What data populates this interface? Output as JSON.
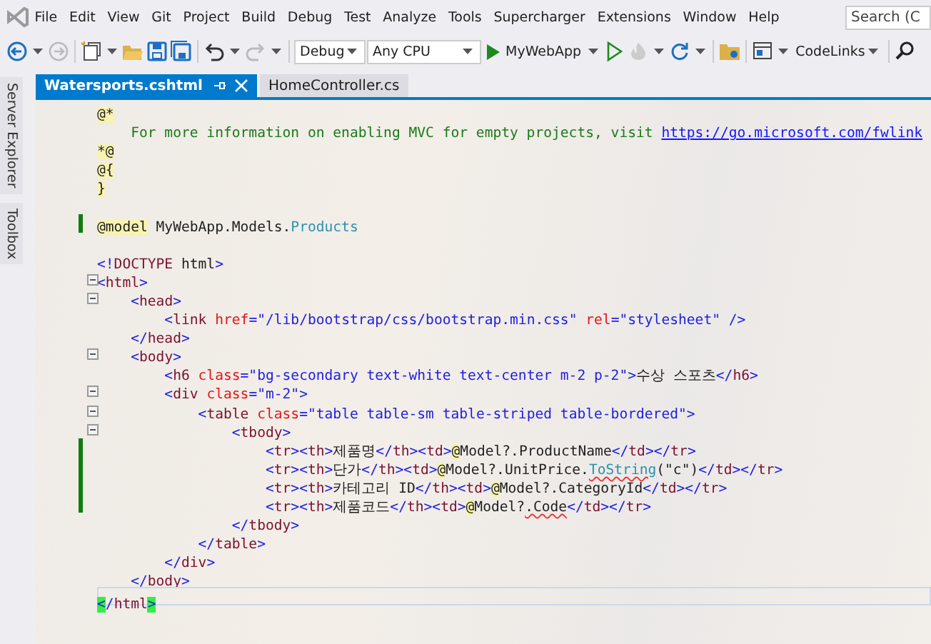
{
  "menu": [
    {
      "label": "File"
    },
    {
      "label": "Edit"
    },
    {
      "label": "View"
    },
    {
      "label": "Git"
    },
    {
      "label": "Project"
    },
    {
      "label": "Build"
    },
    {
      "label": "Debug"
    },
    {
      "label": "Test"
    },
    {
      "label": "Analyze"
    },
    {
      "label": "Tools"
    },
    {
      "label": "Supercharger"
    },
    {
      "label": "Extensions"
    },
    {
      "label": "Window"
    },
    {
      "label": "Help"
    }
  ],
  "search": {
    "placeholder": "Search (C"
  },
  "toolbar": {
    "configuration": "Debug",
    "platform": "Any CPU",
    "run_target": "MyWebApp",
    "codelinks": "CodeLinks"
  },
  "side_tabs": [
    {
      "label": "Server Explorer"
    },
    {
      "label": "Toolbox"
    }
  ],
  "tabs": [
    {
      "label": "Watersports.cshtml",
      "selected": true
    },
    {
      "label": "HomeController.cs",
      "selected": false
    }
  ],
  "lines": [
    {
      "fold": false,
      "changed": false,
      "current": false,
      "tokens": [
        {
          "kind": "razor",
          "text": "@*"
        }
      ]
    },
    {
      "fold": false,
      "changed": false,
      "current": false,
      "tokens": [
        {
          "kind": "comment",
          "text": "    For more information on enabling MVC for empty projects, visit "
        },
        {
          "kind": "link",
          "text": "https://go.microsoft.com/fwlink"
        }
      ]
    },
    {
      "fold": false,
      "changed": false,
      "current": false,
      "tokens": [
        {
          "kind": "razor",
          "text": "*@"
        }
      ]
    },
    {
      "fold": false,
      "changed": false,
      "current": false,
      "tokens": [
        {
          "kind": "razor",
          "text": "@{"
        }
      ]
    },
    {
      "fold": false,
      "changed": false,
      "current": false,
      "tokens": [
        {
          "kind": "razor",
          "text": "}"
        }
      ]
    },
    {
      "fold": false,
      "changed": false,
      "current": false
    },
    {
      "fold": false,
      "changed": true,
      "current": false,
      "tokens": [
        {
          "kind": "razor",
          "text": "@model"
        },
        {
          "kind": "text",
          "text": " MyWebApp.Models."
        },
        {
          "kind": "type",
          "text": "Products"
        }
      ]
    },
    {
      "fold": false,
      "changed": false,
      "current": false
    },
    {
      "fold": false,
      "changed": false,
      "current": false,
      "tokens": [
        {
          "kind": "delim",
          "text": "<!"
        },
        {
          "kind": "tag",
          "text": "DOCTYPE"
        },
        {
          "kind": "text",
          "text": " html"
        },
        {
          "kind": "delim",
          "text": ">"
        }
      ]
    },
    {
      "fold": true,
      "changed": false,
      "current": false,
      "tokens": [
        {
          "kind": "delim",
          "text": "<"
        },
        {
          "kind": "tag",
          "text": "html"
        },
        {
          "kind": "delim",
          "text": ">"
        }
      ]
    },
    {
      "fold": true,
      "changed": false,
      "current": false,
      "tokens": [
        {
          "kind": "delim",
          "text": "    <"
        },
        {
          "kind": "tag",
          "text": "head"
        },
        {
          "kind": "delim",
          "text": ">"
        }
      ]
    },
    {
      "fold": false,
      "changed": false,
      "current": false,
      "tokens": [
        {
          "kind": "delim",
          "text": "        <"
        },
        {
          "kind": "tag",
          "text": "link"
        },
        {
          "kind": "attr",
          "text": " href"
        },
        {
          "kind": "value",
          "text": "=\"/lib/bootstrap/css/bootstrap.min.css\""
        },
        {
          "kind": "attr",
          "text": " rel"
        },
        {
          "kind": "value",
          "text": "=\"stylesheet\""
        },
        {
          "kind": "delim",
          "text": " />"
        }
      ]
    },
    {
      "fold": false,
      "changed": false,
      "current": false,
      "tokens": [
        {
          "kind": "delim",
          "text": "    </"
        },
        {
          "kind": "tag",
          "text": "head"
        },
        {
          "kind": "delim",
          "text": ">"
        }
      ]
    },
    {
      "fold": true,
      "changed": false,
      "current": false,
      "tokens": [
        {
          "kind": "delim",
          "text": "    <"
        },
        {
          "kind": "tag",
          "text": "body"
        },
        {
          "kind": "delim",
          "text": ">"
        }
      ]
    },
    {
      "fold": false,
      "changed": false,
      "current": false,
      "tokens": [
        {
          "kind": "delim",
          "text": "        <"
        },
        {
          "kind": "tag",
          "text": "h6"
        },
        {
          "kind": "attr",
          "text": " class"
        },
        {
          "kind": "value",
          "text": "=\"bg-secondary text-white text-center m-2 p-2\">"
        },
        {
          "kind": "text",
          "text": "수상 스포츠"
        },
        {
          "kind": "delim",
          "text": "</"
        },
        {
          "kind": "tag",
          "text": "h6"
        },
        {
          "kind": "delim",
          "text": ">"
        }
      ]
    },
    {
      "fold": true,
      "changed": false,
      "current": false,
      "tokens": [
        {
          "kind": "delim",
          "text": "        <"
        },
        {
          "kind": "tag",
          "text": "div"
        },
        {
          "kind": "attr",
          "text": " class"
        },
        {
          "kind": "value",
          "text": "=\"m-2\">"
        }
      ]
    },
    {
      "fold": true,
      "changed": false,
      "current": false,
      "tokens": [
        {
          "kind": "delim",
          "text": "            <"
        },
        {
          "kind": "tag",
          "text": "table"
        },
        {
          "kind": "attr",
          "text": " class"
        },
        {
          "kind": "value",
          "text": "=\"table table-sm table-striped table-bordered\">"
        }
      ]
    },
    {
      "fold": true,
      "changed": false,
      "current": false,
      "tokens": [
        {
          "kind": "delim",
          "text": "                <"
        },
        {
          "kind": "tag",
          "text": "tbody"
        },
        {
          "kind": "delim",
          "text": ">"
        }
      ]
    },
    {
      "fold": false,
      "changed": true,
      "current": false,
      "tokens": [
        {
          "kind": "delim",
          "text": "                    <"
        },
        {
          "kind": "tag",
          "text": "tr"
        },
        {
          "kind": "delim",
          "text": "><"
        },
        {
          "kind": "tag",
          "text": "th"
        },
        {
          "kind": "delim",
          "text": ">"
        },
        {
          "kind": "text",
          "text": "제품명"
        },
        {
          "kind": "delim",
          "text": "</"
        },
        {
          "kind": "tag",
          "text": "th"
        },
        {
          "kind": "delim",
          "text": "><"
        },
        {
          "kind": "tag",
          "text": "td"
        },
        {
          "kind": "delim",
          "text": ">"
        },
        {
          "kind": "razor",
          "text": "@"
        },
        {
          "kind": "text",
          "text": "Model?.ProductName"
        },
        {
          "kind": "delim",
          "text": "</"
        },
        {
          "kind": "tag",
          "text": "td"
        },
        {
          "kind": "delim",
          "text": "></"
        },
        {
          "kind": "tag",
          "text": "tr"
        },
        {
          "kind": "delim",
          "text": ">"
        }
      ]
    },
    {
      "fold": false,
      "changed": true,
      "current": false,
      "tokens": [
        {
          "kind": "delim",
          "text": "                    <"
        },
        {
          "kind": "tag",
          "text": "tr"
        },
        {
          "kind": "delim",
          "text": "><"
        },
        {
          "kind": "tag",
          "text": "th"
        },
        {
          "kind": "delim",
          "text": ">"
        },
        {
          "kind": "text",
          "text": "단가"
        },
        {
          "kind": "delim",
          "text": "</"
        },
        {
          "kind": "tag",
          "text": "th"
        },
        {
          "kind": "delim",
          "text": "><"
        },
        {
          "kind": "tag",
          "text": "td"
        },
        {
          "kind": "delim",
          "text": ">"
        },
        {
          "kind": "razor",
          "text": "@"
        },
        {
          "kind": "text",
          "text": "Model?.UnitPrice."
        },
        {
          "kind": "method_error",
          "text": "ToString"
        },
        {
          "kind": "text",
          "text": "(\"c\")"
        },
        {
          "kind": "delim",
          "text": "</"
        },
        {
          "kind": "tag",
          "text": "td"
        },
        {
          "kind": "delim",
          "text": "></"
        },
        {
          "kind": "tag",
          "text": "tr"
        },
        {
          "kind": "delim",
          "text": ">"
        }
      ]
    },
    {
      "fold": false,
      "changed": true,
      "current": false,
      "tokens": [
        {
          "kind": "delim",
          "text": "                    <"
        },
        {
          "kind": "tag",
          "text": "tr"
        },
        {
          "kind": "delim",
          "text": "><"
        },
        {
          "kind": "tag",
          "text": "th"
        },
        {
          "kind": "delim",
          "text": ">"
        },
        {
          "kind": "text",
          "text": "카테고리 ID"
        },
        {
          "kind": "delim",
          "text": "</"
        },
        {
          "kind": "tag",
          "text": "th"
        },
        {
          "kind": "delim",
          "text": "><"
        },
        {
          "kind": "tag",
          "text": "td"
        },
        {
          "kind": "delim",
          "text": ">"
        },
        {
          "kind": "razor",
          "text": "@"
        },
        {
          "kind": "text",
          "text": "Model?.CategoryId"
        },
        {
          "kind": "delim",
          "text": "</"
        },
        {
          "kind": "tag",
          "text": "td"
        },
        {
          "kind": "delim",
          "text": "></"
        },
        {
          "kind": "tag",
          "text": "tr"
        },
        {
          "kind": "delim",
          "text": ">"
        }
      ]
    },
    {
      "fold": false,
      "changed": true,
      "current": false,
      "tokens": [
        {
          "kind": "delim",
          "text": "                    <"
        },
        {
          "kind": "tag",
          "text": "tr"
        },
        {
          "kind": "delim",
          "text": "><"
        },
        {
          "kind": "tag",
          "text": "th"
        },
        {
          "kind": "delim",
          "text": ">"
        },
        {
          "kind": "text",
          "text": "제품코드"
        },
        {
          "kind": "delim",
          "text": "</"
        },
        {
          "kind": "tag",
          "text": "th"
        },
        {
          "kind": "delim",
          "text": "><"
        },
        {
          "kind": "tag",
          "text": "td"
        },
        {
          "kind": "delim",
          "text": ">"
        },
        {
          "kind": "razor",
          "text": "@"
        },
        {
          "kind": "text",
          "text": "Model?"
        },
        {
          "kind": "error",
          "text": ".Code"
        },
        {
          "kind": "delim",
          "text": "</"
        },
        {
          "kind": "tag",
          "text": "td"
        },
        {
          "kind": "delim",
          "text": "></"
        },
        {
          "kind": "tag",
          "text": "tr"
        },
        {
          "kind": "delim",
          "text": ">"
        }
      ]
    },
    {
      "fold": false,
      "changed": false,
      "current": false,
      "tokens": [
        {
          "kind": "delim",
          "text": "                </"
        },
        {
          "kind": "tag",
          "text": "tbody"
        },
        {
          "kind": "delim",
          "text": ">"
        }
      ]
    },
    {
      "fold": false,
      "changed": false,
      "current": false,
      "tokens": [
        {
          "kind": "delim",
          "text": "            </"
        },
        {
          "kind": "tag",
          "text": "table"
        },
        {
          "kind": "delim",
          "text": ">"
        }
      ]
    },
    {
      "fold": false,
      "changed": false,
      "current": false,
      "tokens": [
        {
          "kind": "delim",
          "text": "        </"
        },
        {
          "kind": "tag",
          "text": "div"
        },
        {
          "kind": "delim",
          "text": ">"
        }
      ]
    },
    {
      "fold": false,
      "changed": false,
      "current": false,
      "tokens": [
        {
          "kind": "delim",
          "text": "    </"
        },
        {
          "kind": "tag",
          "text": "body"
        },
        {
          "kind": "delim",
          "text": ">"
        }
      ]
    },
    {
      "fold": false,
      "changed": false,
      "current": true,
      "tokens": [
        {
          "kind": "match",
          "text": "<"
        },
        {
          "kind": "delim",
          "text": "/"
        },
        {
          "kind": "tag",
          "text": "html"
        },
        {
          "kind": "match",
          "text": ">"
        }
      ]
    }
  ]
}
